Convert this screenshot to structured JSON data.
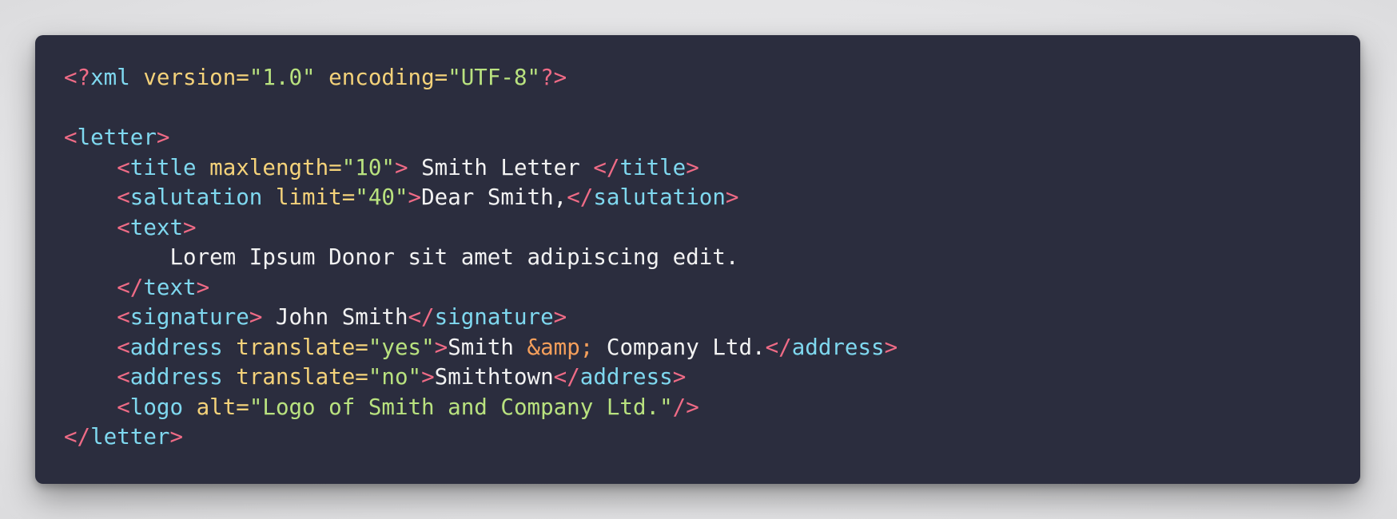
{
  "colors": {
    "background": "#2b2d3e",
    "punctuation": "#ef6b86",
    "tag": "#7fd8ef",
    "attribute": "#f4d27a",
    "value": "#b9e27f",
    "entity": "#f59f5b",
    "text": "#f2f2f2"
  },
  "code": {
    "l1": {
      "open": "<?",
      "name": "xml",
      "attr1": "version=",
      "val1": "\"1.0\"",
      "attr2": "encoding=",
      "val2": "\"UTF-8\"",
      "close": "?>"
    },
    "letter": {
      "lt": "<",
      "name": "letter",
      "gt": ">",
      "close_lt": "</",
      "close_gt": ">"
    },
    "title": {
      "name": "title",
      "attr": "maxlength=",
      "val": "\"10\"",
      "text": " Smith Letter ",
      "close_name": "title"
    },
    "salutation": {
      "name": "salutation",
      "attr": "limit=",
      "val": "\"40\"",
      "text": "Dear Smith,",
      "close_name": "salutation"
    },
    "text": {
      "name": "text",
      "content": "Lorem Ipsum Donor sit amet adipiscing edit.",
      "close_name": "text"
    },
    "signature": {
      "name": "signature",
      "text": " John Smith",
      "close_name": "signature"
    },
    "address1": {
      "name": "address",
      "attr": "translate=",
      "val": "\"yes\"",
      "text_before": "Smith ",
      "entity": "&amp;",
      "text_after": " Company Ltd.",
      "close_name": "address"
    },
    "address2": {
      "name": "address",
      "attr": "translate=",
      "val": "\"no\"",
      "text": "Smithtown",
      "close_name": "address"
    },
    "logo": {
      "name": "logo",
      "attr": "alt=",
      "val": "\"Logo of Smith and Company Ltd.\"",
      "selfclose": "/>"
    },
    "punct": {
      "lt": "<",
      "gt": ">",
      "end": "</"
    }
  }
}
